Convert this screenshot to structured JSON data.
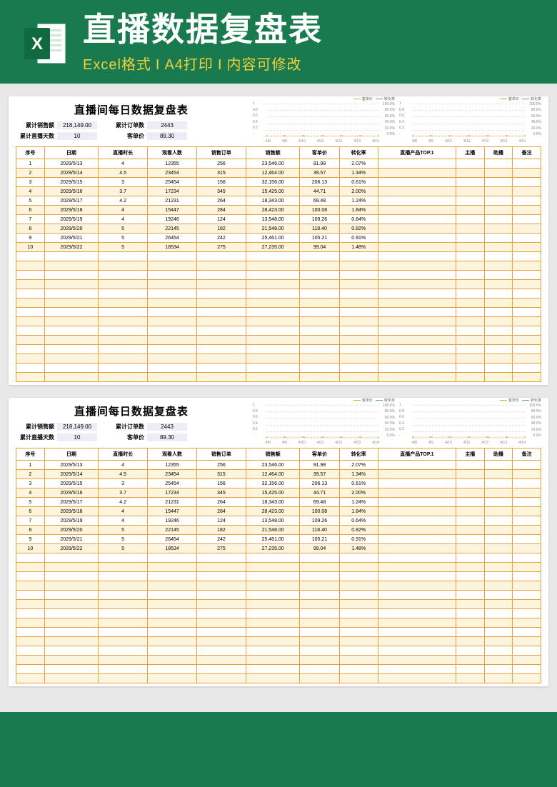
{
  "banner": {
    "title": "直播数据复盘表",
    "sub1": "Excel格式",
    "sub2": "A4打印",
    "sub3": "内容可修改"
  },
  "sheet": {
    "title": "直播间每日数据复盘表",
    "summary": {
      "lab_sales": "累计销售额",
      "val_sales": "218,149.00",
      "lab_orders": "累计订单数",
      "val_orders": "2443",
      "lab_days": "累计直播天数",
      "val_days": "10",
      "lab_avg": "客单价",
      "val_avg": "89.30"
    },
    "headers": [
      "序号",
      "日期",
      "直播时长",
      "观看人数",
      "销售订单",
      "销售额",
      "客单价",
      "转化率",
      "直播产品TOP.1",
      "主播",
      "助播",
      "备注"
    ],
    "rows": [
      [
        "1",
        "2029/5/13",
        "4",
        "12355",
        "256",
        "23,546.00",
        "91.98",
        "2.07%",
        "",
        "",
        "",
        ""
      ],
      [
        "2",
        "2029/5/14",
        "4.5",
        "23454",
        "315",
        "12,464.00",
        "39.57",
        "1.34%",
        "",
        "",
        "",
        ""
      ],
      [
        "3",
        "2029/5/15",
        "3",
        "25454",
        "156",
        "32,156.00",
        "206.13",
        "0.61%",
        "",
        "",
        "",
        ""
      ],
      [
        "4",
        "2029/5/16",
        "3.7",
        "17234",
        "345",
        "15,425.00",
        "44.71",
        "2.00%",
        "",
        "",
        "",
        ""
      ],
      [
        "5",
        "2029/5/17",
        "4.2",
        "21231",
        "264",
        "18,343.00",
        "69.48",
        "1.24%",
        "",
        "",
        "",
        ""
      ],
      [
        "6",
        "2029/5/18",
        "4",
        "15447",
        "284",
        "28,423.00",
        "100.08",
        "1.84%",
        "",
        "",
        "",
        ""
      ],
      [
        "7",
        "2029/5/19",
        "4",
        "19246",
        "124",
        "13,548.00",
        "109.26",
        "0.64%",
        "",
        "",
        "",
        ""
      ],
      [
        "8",
        "2029/5/20",
        "5",
        "22145",
        "182",
        "21,548.00",
        "118.40",
        "0.82%",
        "",
        "",
        "",
        ""
      ],
      [
        "9",
        "2029/5/21",
        "5",
        "26454",
        "242",
        "25,461.00",
        "105.21",
        "0.91%",
        "",
        "",
        "",
        ""
      ],
      [
        "10",
        "2029/5/22",
        "5",
        "18534",
        "275",
        "27,235.00",
        "99.04",
        "1.48%",
        "",
        "",
        "",
        ""
      ]
    ],
    "empty_rows": 14
  },
  "chart_data": [
    {
      "type": "line",
      "title": "",
      "legend": [
        "客单价",
        "转化率"
      ],
      "x": [
        "4/8",
        "4/9",
        "4/10",
        "4/11",
        "4/12",
        "4/13",
        "4/14"
      ],
      "y_left": [
        1.0,
        0.8,
        0.6,
        0.4,
        0.2,
        "-"
      ],
      "y_right": [
        "100.0%",
        "80.0%",
        "60.0%",
        "40.0%",
        "20.0%",
        "0.0%"
      ],
      "series": [
        {
          "name": "客单价",
          "values": [
            0,
            0,
            0,
            0,
            0,
            0,
            0
          ]
        },
        {
          "name": "转化率",
          "values": [
            0,
            0,
            0,
            0,
            0,
            0,
            0
          ]
        }
      ]
    },
    {
      "type": "line",
      "title": "",
      "legend": [
        "客单价",
        "转化率"
      ],
      "x": [
        "4/8",
        "4/9",
        "4/10",
        "4/11",
        "4/12",
        "4/13",
        "4/14"
      ],
      "y_left": [
        1.0,
        0.8,
        0.6,
        0.4,
        0.2,
        "-"
      ],
      "y_right": [
        "100.0%",
        "80.0%",
        "60.0%",
        "40.0%",
        "20.0%",
        "0.0%"
      ],
      "series": [
        {
          "name": "客单价",
          "values": [
            0,
            0,
            0,
            0,
            0,
            0,
            0
          ]
        },
        {
          "name": "转化率",
          "values": [
            0,
            0,
            0,
            0,
            0,
            0,
            0
          ]
        }
      ]
    }
  ]
}
